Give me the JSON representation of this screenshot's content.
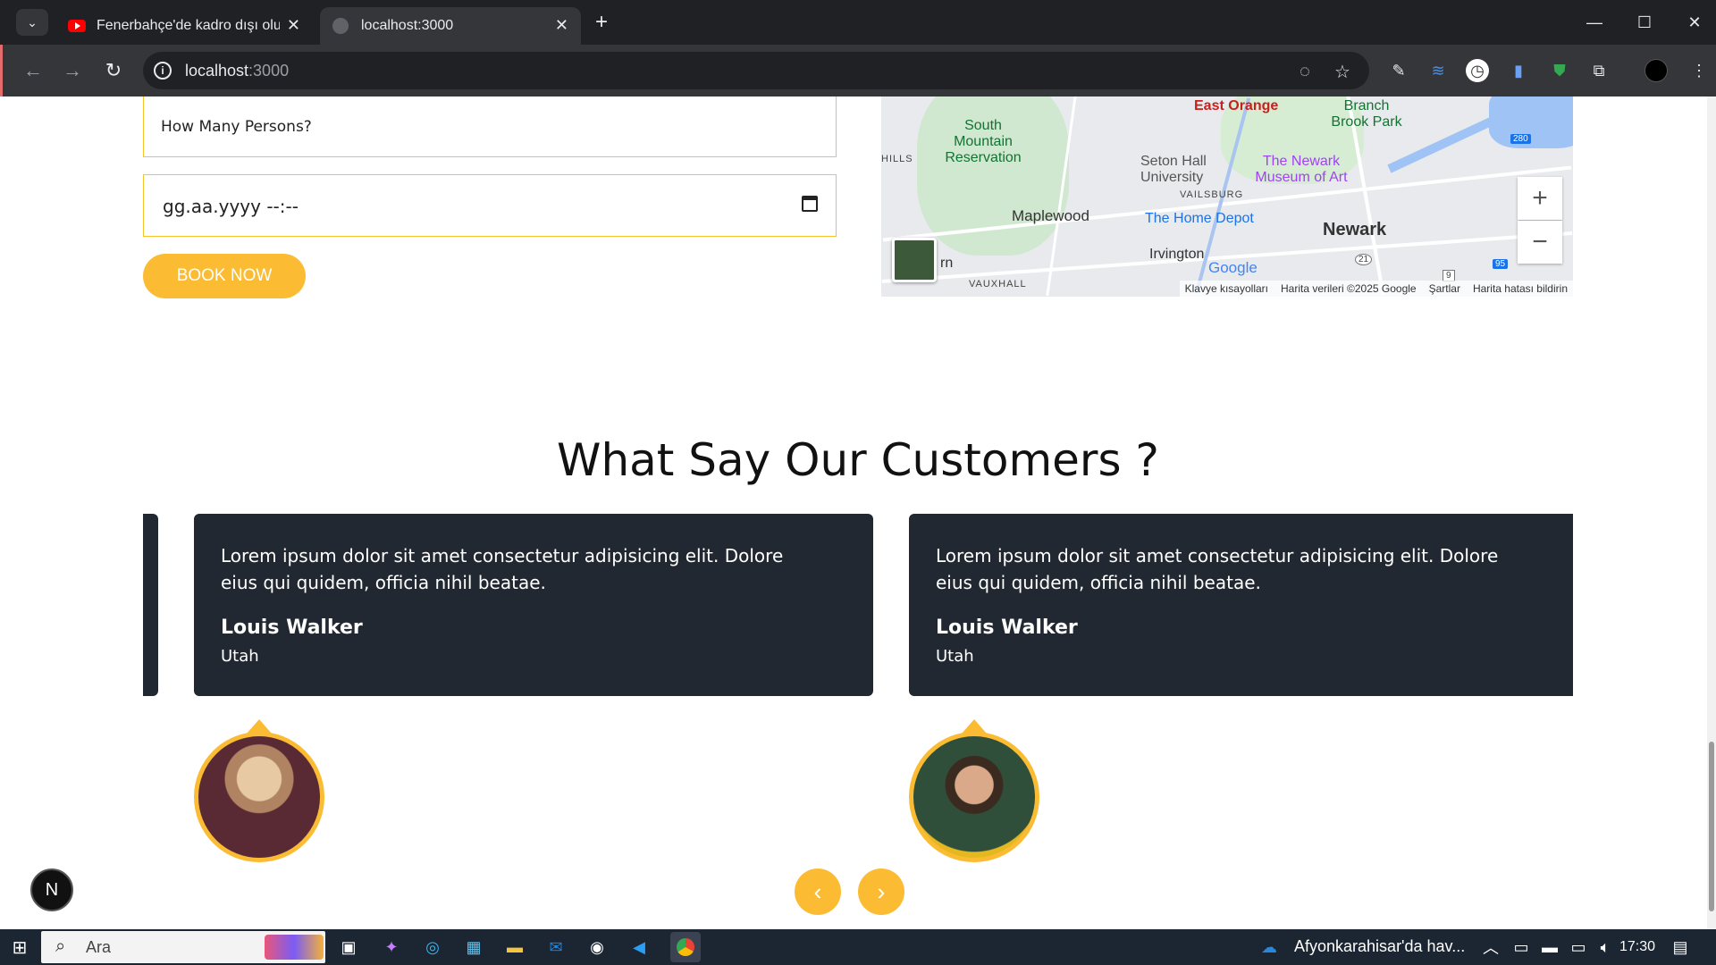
{
  "browser": {
    "tabs": [
      {
        "title": "Fenerbahçe'de kadro dışı olur m",
        "active": false
      },
      {
        "title": "localhost:3000",
        "active": true
      }
    ],
    "url_host": "localhost",
    "url_port": ":3000"
  },
  "form": {
    "persons_placeholder": "How Many Persons?",
    "datetime_placeholder": "gg.aa.yyyy --:--",
    "book_label": "BOOK NOW"
  },
  "map": {
    "labels": [
      "East Orange",
      "Branch Brook Park",
      "South Mountain Reservation",
      "HILLS",
      "Seton Hall University",
      "The Newark Museum of Art",
      "VAILSBURG",
      "Maplewood",
      "The Home Depot",
      "Newark",
      "Irvington",
      "Google",
      "VAUXHALL",
      "rn"
    ],
    "road_shields": [
      "280",
      "21",
      "95",
      "9"
    ],
    "attribution": {
      "shortcuts": "Klavye kısayolları",
      "data": "Harita verileri ©2025 Google",
      "terms": "Şartlar",
      "report": "Harita hatası bildirin"
    },
    "zoom_in": "+",
    "zoom_out": "−"
  },
  "testimonials": {
    "heading": "What Say Our Customers ?",
    "items": [
      {
        "quote": "Lorem ipsum dolor sit amet consectetur adipisicing elit. Dolore eius qui quidem, officia nihil beatae.",
        "name": "Louis Walker",
        "city": "Utah"
      },
      {
        "quote": "Lorem ipsum dolor sit amet consectetur adipisicing elit. Dolore eius qui quidem, officia nihil beatae.",
        "name": "Louis Walker",
        "city": "Utah"
      }
    ],
    "prev": "‹",
    "next": "›"
  },
  "devtools_badge": "N",
  "taskbar": {
    "search_label": "Ara",
    "weather_text": "Afyonkarahisar'da hav...",
    "time": "17:30"
  },
  "colors": {
    "accent": "#fbbc34",
    "card_bg": "#222831"
  }
}
